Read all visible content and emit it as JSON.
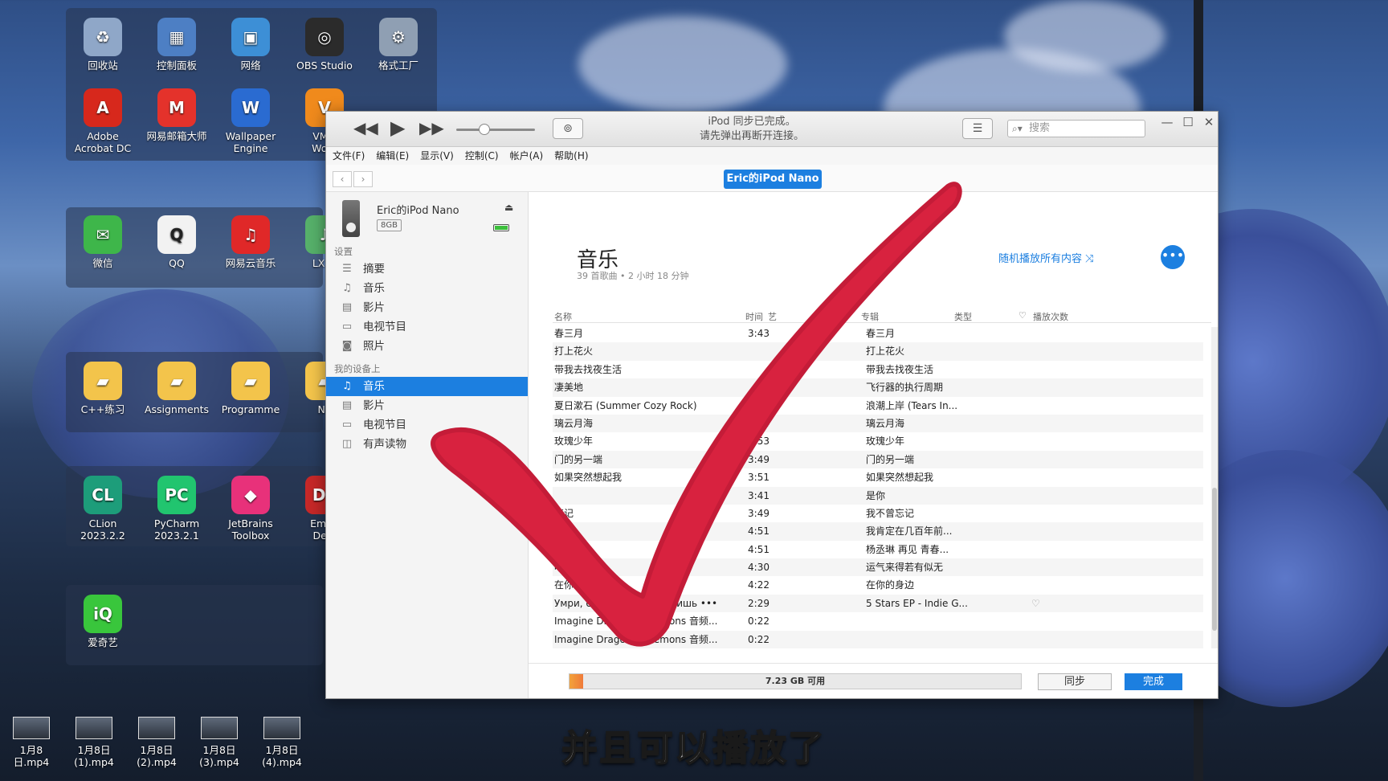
{
  "desktop": {
    "icons": [
      {
        "label": "回收站",
        "icon": "recycle-bin-icon",
        "color": "#8fa7c8",
        "glyph": "♻"
      },
      {
        "label": "控制面板",
        "icon": "control-panel-icon",
        "color": "#4d7fc4",
        "glyph": "▦"
      },
      {
        "label": "网络",
        "icon": "network-icon",
        "color": "#3d8fd6",
        "glyph": "▣"
      },
      {
        "label": "OBS Studio",
        "icon": "obs-icon",
        "color": "#2b2b2b",
        "glyph": "◎"
      },
      {
        "label": "格式工厂",
        "icon": "format-factory-icon",
        "color": "#8f9fb3",
        "glyph": "⚙"
      },
      {
        "label": "Adobe\nAcrobat DC",
        "icon": "acrobat-icon",
        "color": "#d7281c",
        "glyph": "A"
      },
      {
        "label": "网易邮箱大师",
        "icon": "mail-master-icon",
        "color": "#e4322b",
        "glyph": "M"
      },
      {
        "label": "Wallpaper\nEngine",
        "icon": "wallpaper-engine-icon",
        "color": "#2a6bd1",
        "glyph": "W"
      },
      {
        "label": "VMw\nWork",
        "icon": "vmware-icon",
        "color": "#f08a1c",
        "glyph": "V"
      },
      {
        "label": "微信",
        "icon": "wechat-icon",
        "color": "#3eb64a",
        "glyph": "✉"
      },
      {
        "label": "QQ",
        "icon": "qq-icon",
        "color": "#f2f2f2",
        "glyph": "Q"
      },
      {
        "label": "网易云音乐",
        "icon": "netease-music-icon",
        "color": "#e02828",
        "glyph": "♫"
      },
      {
        "label": "LX M",
        "icon": "lx-music-icon",
        "color": "#56b06a",
        "glyph": "♪"
      },
      {
        "label": "C++练习",
        "icon": "folder-icon",
        "color": "#f3c44b",
        "glyph": "▰"
      },
      {
        "label": "Assignments",
        "icon": "folder-icon",
        "color": "#f3c44b",
        "glyph": "▰"
      },
      {
        "label": "Programme",
        "icon": "folder-icon",
        "color": "#f3c44b",
        "glyph": "▰"
      },
      {
        "label": "No",
        "icon": "folder-icon",
        "color": "#f3c44b",
        "glyph": "▰"
      },
      {
        "label": "CLion\n2023.2.2",
        "icon": "clion-icon",
        "color": "#1d9d7a",
        "glyph": "CL"
      },
      {
        "label": "PyCharm\n2023.2.1",
        "icon": "pycharm-icon",
        "color": "#21c56f",
        "glyph": "PC"
      },
      {
        "label": "JetBrains\nToolbox",
        "icon": "jetbrains-toolbox-icon",
        "color": "#e8317a",
        "glyph": "◆"
      },
      {
        "label": "Emba\nDev-",
        "icon": "embarcadero-icon",
        "color": "#c62828",
        "glyph": "DE"
      },
      {
        "label": "爱奇艺",
        "icon": "iqiyi-icon",
        "color": "#39c63c",
        "glyph": "iQ"
      }
    ],
    "videos": [
      "1月8日.mp4",
      "1月8日\n(1).mp4",
      "1月8日\n(2).mp4",
      "1月8日\n(3).mp4",
      "1月8日\n(4).mp4"
    ]
  },
  "window": {
    "status_line1": "iPod 同步已完成。",
    "status_line2": "请先弹出再断开连接。",
    "search_placeholder": "搜索",
    "menu": [
      "文件(F)",
      "编辑(E)",
      "显示(V)",
      "控制(C)",
      "帐户(A)",
      "帮助(H)"
    ],
    "device_pill": "Eric的iPod Nano"
  },
  "sidebar": {
    "device_name": "Eric的iPod Nano",
    "capacity": "8GB",
    "settings_title": "设置",
    "settings_items": [
      {
        "label": "摘要",
        "icon": "summary-icon",
        "glyph": "☰"
      },
      {
        "label": "音乐",
        "icon": "music-note-icon",
        "glyph": "♫"
      },
      {
        "label": "影片",
        "icon": "film-icon",
        "glyph": "▤"
      },
      {
        "label": "电视节目",
        "icon": "tv-icon",
        "glyph": "▭"
      },
      {
        "label": "照片",
        "icon": "camera-icon",
        "glyph": "◙"
      }
    ],
    "ondevice_title": "我的设备上",
    "ondevice_items": [
      {
        "label": "音乐",
        "icon": "music-note-icon",
        "glyph": "♫"
      },
      {
        "label": "影片",
        "icon": "film-icon",
        "glyph": "▤"
      },
      {
        "label": "电视节目",
        "icon": "tv-icon",
        "glyph": "▭"
      },
      {
        "label": "有声读物",
        "icon": "audiobook-icon",
        "glyph": "◫"
      }
    ]
  },
  "main": {
    "title": "音乐",
    "subtitle": "39 首歌曲 • 2 小时 18 分钟",
    "shuffle_label": "随机播放所有内容",
    "columns": {
      "name": "名称",
      "time": "时间",
      "artist": "艺",
      "album": "专辑",
      "genre": "类型",
      "plays": "播放次数"
    },
    "rows": [
      {
        "name": "春三月",
        "time": "3:43",
        "album": "春三月",
        "heart": ""
      },
      {
        "name": "打上花火",
        "time": "",
        "album": "打上花火",
        "heart": ""
      },
      {
        "name": "带我去找夜生活",
        "time": "",
        "album": "带我去找夜生活",
        "heart": ""
      },
      {
        "name": "凄美地",
        "time": "",
        "album": "飞行器的执行周期",
        "heart": ""
      },
      {
        "name": "夏日漱石 (Summer Cozy Rock)",
        "time": "",
        "album": "浪潮上岸 (Tears In...",
        "heart": ""
      },
      {
        "name": "璃云月海",
        "time": "4",
        "album": "璃云月海",
        "heart": ""
      },
      {
        "name": "玫瑰少年",
        "time": "3:53",
        "album": "玫瑰少年",
        "heart": ""
      },
      {
        "name": "门的另一端",
        "time": "3:49",
        "album": "门的另一端",
        "heart": ""
      },
      {
        "name": "如果突然想起我",
        "time": "3:51",
        "album": "如果突然想起我",
        "heart": ""
      },
      {
        "name": "",
        "time": "3:41",
        "album": "是你",
        "heart": ""
      },
      {
        "name": "忘记",
        "time": "3:49",
        "album": "我不曾忘记",
        "heart": ""
      },
      {
        "name": "",
        "time": "4:51",
        "album": "我肯定在几百年前...",
        "heart": ""
      },
      {
        "name": "带",
        "time": "4:51",
        "album": "杨丞琳 再见 青春...",
        "heart": ""
      },
      {
        "name": "唯一",
        "time": "4:30",
        "album": "运气来得若有似无",
        "heart": ""
      },
      {
        "name": "在你的身边",
        "time": "4:22",
        "album": "在你的身边",
        "heart": ""
      },
      {
        "name": "Умри, если меня не любишь  •••",
        "time": "2:29",
        "album": "5 Stars EP - Indie G...",
        "heart": "♡"
      },
      {
        "name": "Imagine Dragons - Demons 音频...",
        "time": "0:22",
        "album": "",
        "heart": ""
      },
      {
        "name": "Imagine Dragons - Demons 音频...",
        "time": "0:22",
        "album": "",
        "heart": ""
      }
    ],
    "capacity_text": "7.23 GB 可用",
    "capacity_used_fraction": 0.03,
    "sync_label": "同步",
    "done_label": "完成"
  },
  "caption": "并且可以播放了"
}
